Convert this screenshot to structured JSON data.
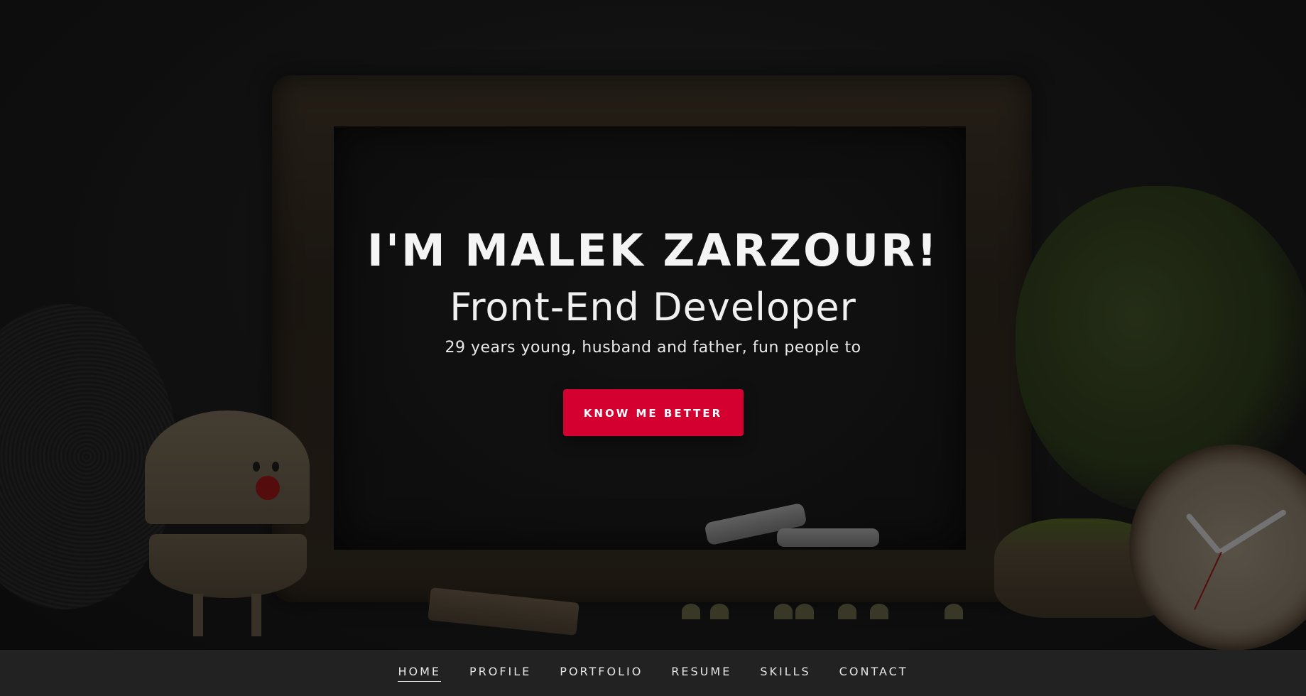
{
  "hero": {
    "title": "I'M MALEK ZARZOUR!",
    "subtitle": "Front-End Developer",
    "tagline": "29 years young, husband and father, fun people to",
    "cta_label": "KNOW ME BETTER"
  },
  "nav": {
    "items": [
      {
        "label": "HOME",
        "active": true
      },
      {
        "label": "PROFILE",
        "active": false
      },
      {
        "label": "PORTFOLIO",
        "active": false
      },
      {
        "label": "RESUME",
        "active": false
      },
      {
        "label": "SKILLS",
        "active": false
      },
      {
        "label": "CONTACT",
        "active": false
      }
    ]
  },
  "colors": {
    "accent": "#d30030",
    "nav_background": "#222222",
    "hero_background": "#1a1a1a",
    "text": "#ffffff"
  }
}
